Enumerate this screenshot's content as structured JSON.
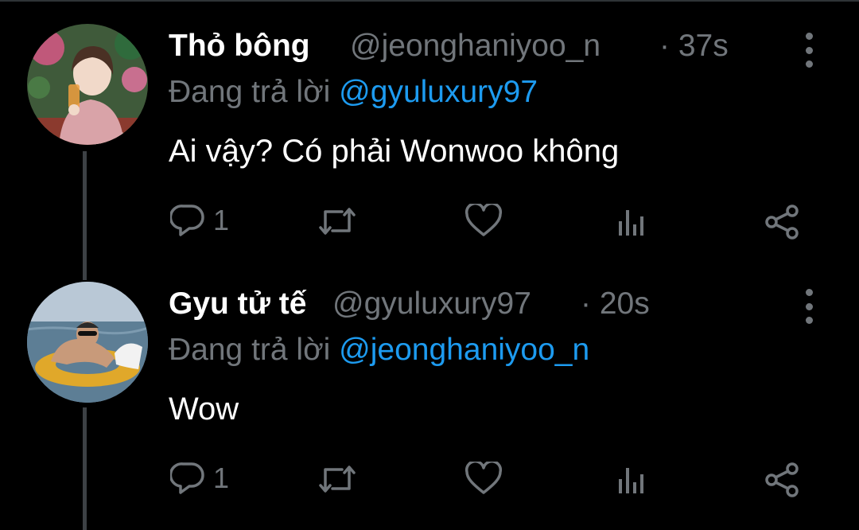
{
  "colors": {
    "background": "#000000",
    "name": "#ffffff",
    "secondary": "#71767b",
    "link": "#1d9bf0",
    "thread_line": "#3d4145"
  },
  "tweets": [
    {
      "display_name": "Thỏ bông",
      "handle": "@jeonghaniyoo_n",
      "time": "· 37s",
      "reply_prefix": "Đang trả lời",
      "reply_to": "@gyuluxury97",
      "text": "Ai vậy? Có phải Wonwoo không",
      "reply_count": "1",
      "icons": [
        "reply-icon",
        "retweet-icon",
        "like-icon",
        "analytics-icon",
        "share-icon",
        "more-icon"
      ]
    },
    {
      "display_name": "Gyu tử tế",
      "handle": "@gyuluxury97",
      "time": "· 20s",
      "reply_prefix": "Đang trả lời",
      "reply_to": "@jeonghaniyoo_n",
      "text": "Wow",
      "reply_count": "1",
      "icons": [
        "reply-icon",
        "retweet-icon",
        "like-icon",
        "analytics-icon",
        "share-icon",
        "more-icon"
      ]
    }
  ]
}
